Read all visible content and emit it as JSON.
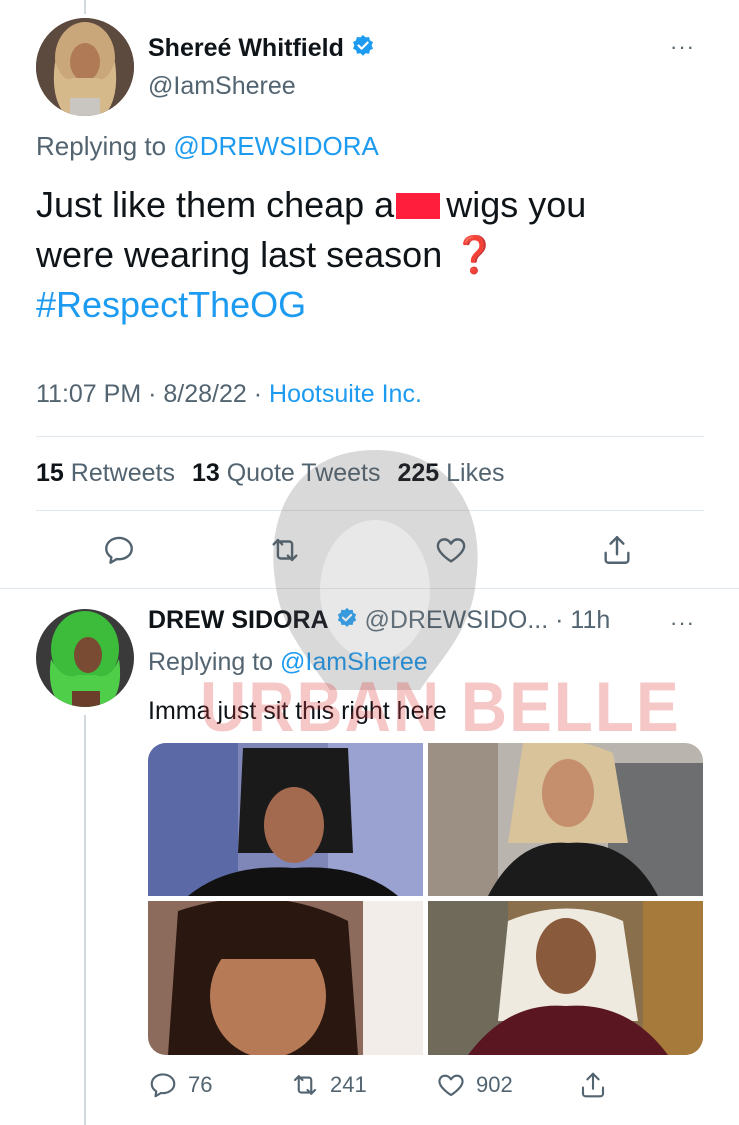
{
  "main_tweet": {
    "display_name": "Shereé Whitfield",
    "handle": "@IamSheree",
    "replying_prefix": "Replying to",
    "replying_to": "@DREWSIDORA",
    "text_line1_a": "Just like them cheap a",
    "text_line1_b": "wigs you",
    "text_line2": "were wearing last season",
    "emoji": "❓",
    "hashtag": "#RespectTheOG",
    "time": "11:07 PM",
    "date": "8/28/22",
    "source": "Hootsuite Inc.",
    "separator": "·",
    "stats": {
      "retweets_count": "15",
      "retweets_label": "Retweets",
      "quotes_count": "13",
      "quotes_label": "Quote Tweets",
      "likes_count": "225",
      "likes_label": "Likes"
    },
    "more_label": "···"
  },
  "reply_tweet": {
    "display_name": "DREW SIDORA",
    "handle_time": "@DREWSIDO... · 11h",
    "replying_prefix": "Replying to",
    "replying_to": "@IamSheree",
    "text": "Imma just sit this right here",
    "more_label": "···",
    "actions": {
      "replies": "76",
      "retweets": "241",
      "likes": "902"
    }
  },
  "watermark": {
    "text": "URBAN BELLE"
  },
  "colors": {
    "accent": "#1d9bf0",
    "text": "#0f1419",
    "muted": "#536471",
    "censor": "#ff1f3d",
    "emoji_red": "#e0182d",
    "avatar1_bg": "#6b5a4e",
    "avatar2_bg": "#3a8f3a"
  }
}
